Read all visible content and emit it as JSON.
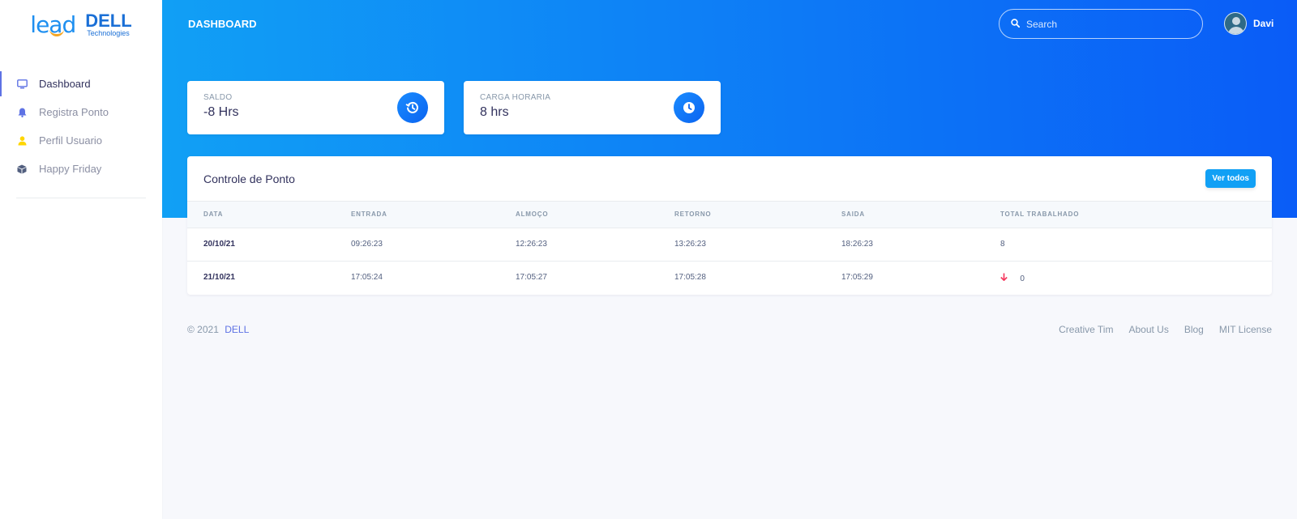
{
  "brand": {
    "lead_logo": "lead",
    "dell_logo": "DELL",
    "dell_sub": "Technologies"
  },
  "sidebar": {
    "items": [
      {
        "label": "Dashboard",
        "icon": "monitor-icon",
        "color": "#5e72e4",
        "active": true
      },
      {
        "label": "Registra Ponto",
        "icon": "bell-icon",
        "color": "#5e72e4"
      },
      {
        "label": "Perfil Usuario",
        "icon": "user-icon",
        "color": "#ffd600"
      },
      {
        "label": "Happy Friday",
        "icon": "box-icon",
        "color": "#525f7f"
      }
    ]
  },
  "header": {
    "title": "DASHBOARD",
    "search_placeholder": "Search",
    "user_name": "Davi"
  },
  "stats": [
    {
      "label": "SALDO",
      "value": "-8 Hrs",
      "icon": "history-icon"
    },
    {
      "label": "CARGA HORARIA",
      "value": "8 hrs",
      "icon": "clock-icon"
    }
  ],
  "table": {
    "title": "Controle de Ponto",
    "button_label": "Ver todos",
    "columns": [
      "DATA",
      "ENTRADA",
      "ALMOÇO",
      "RETORNO",
      "SAIDA",
      "TOTAL TRABALHADO"
    ],
    "rows": [
      [
        "20/10/21",
        "09:26:23",
        "12:26:23",
        "13:26:23",
        "18:26:23",
        "8"
      ],
      [
        "21/10/21",
        "17:05:24",
        "17:05:27",
        "17:05:28",
        "17:05:29",
        "0"
      ]
    ]
  },
  "footer": {
    "copyright": "© 2021",
    "brand": "DELL",
    "links": [
      "Creative Tim",
      "About Us",
      "Blog",
      "MIT License"
    ]
  },
  "colors": {
    "accent": "#5e72e4",
    "header_start": "#11a0f5",
    "header_end": "#0a5cf7",
    "danger": "#f5365c"
  }
}
